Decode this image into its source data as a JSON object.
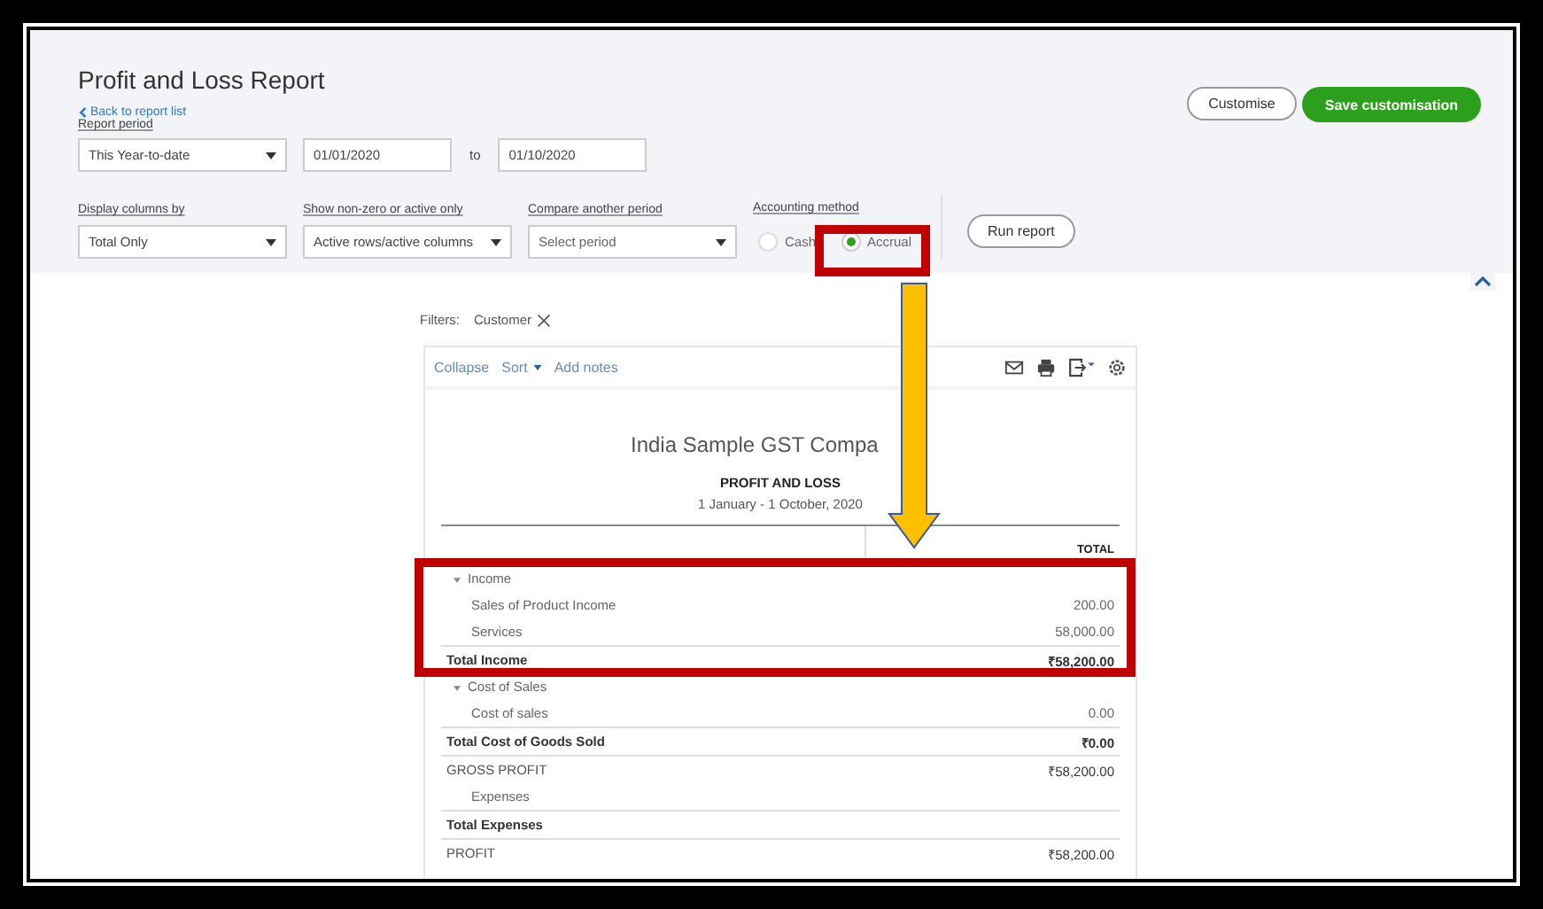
{
  "report": {
    "title": "Profit and Loss Report",
    "back_link": "Back to report list",
    "period": {
      "label": "Report period",
      "value": "This Year-to-date",
      "from": "01/01/2020",
      "to_label": "to",
      "to": "01/10/2020"
    },
    "options": [
      {
        "label": "Display columns by",
        "value": "Total Only"
      },
      {
        "label": "Show non-zero or active only",
        "value": "Active rows/active columns"
      },
      {
        "label": "Compare another period",
        "placeholder": "Select period"
      }
    ],
    "accounting_method": {
      "label": "Accounting method",
      "choices": [
        {
          "label": "Cash",
          "selected": false
        },
        {
          "label": "Accrual",
          "selected": true
        }
      ]
    },
    "run_button": "Run report",
    "customise_button": "Customise",
    "save_button": "Save customisation"
  },
  "filters": {
    "label": "Filters:",
    "chips": [
      "Customer"
    ]
  },
  "toolbar": {
    "links": [
      {
        "label": "Collapse",
        "menu": false
      },
      {
        "label": "Sort",
        "menu": true
      },
      {
        "label": "Add notes",
        "menu": false
      }
    ]
  },
  "statement": {
    "company": "India Sample GST Compa",
    "title": "PROFIT AND LOSS",
    "date_range": "1 January - 1 October, 2020",
    "column": "TOTAL",
    "rows": [
      {
        "kind": "section",
        "label": "Income"
      },
      {
        "kind": "item",
        "label": "Sales of Product Income",
        "amount": "200.00"
      },
      {
        "kind": "item",
        "label": "Services",
        "amount": "58,000.00"
      },
      {
        "kind": "total",
        "label": "Total Income",
        "amount": "₹58,200.00"
      },
      {
        "kind": "section",
        "label": "Cost of Sales"
      },
      {
        "kind": "item",
        "label": "Cost of sales",
        "amount": "0.00"
      },
      {
        "kind": "total",
        "label": "Total Cost of Goods Sold",
        "amount": "₹0.00"
      },
      {
        "kind": "plain",
        "label": "GROSS PROFIT",
        "amount": "₹58,200.00"
      },
      {
        "kind": "item",
        "label": "Expenses"
      },
      {
        "kind": "total",
        "label": "Total Expenses"
      },
      {
        "kind": "plain",
        "label": "PROFIT",
        "amount": "₹58,200.00"
      }
    ]
  }
}
